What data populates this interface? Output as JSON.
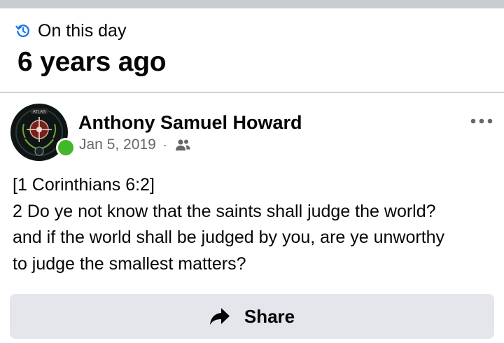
{
  "memory": {
    "label": "On this day",
    "years_ago": "6 years ago"
  },
  "post": {
    "author": "Anthony Samuel Howard",
    "date": "Jan 5, 2019",
    "separator": "·",
    "audience_icon": "friends-icon",
    "avatar_text": "ATLAS",
    "text_lines": [
      "[1 Corinthians 6:2]",
      "2 Do ye not know that the saints shall judge the world?",
      "and if the world shall be judged by you, are ye unworthy",
      "to judge the smallest matters?"
    ],
    "share_label": "Share"
  },
  "colors": {
    "accent_blue": "#1877f2",
    "online_green": "#42b72a",
    "secondary_text": "#65676b",
    "button_bg": "#e4e6eb"
  }
}
